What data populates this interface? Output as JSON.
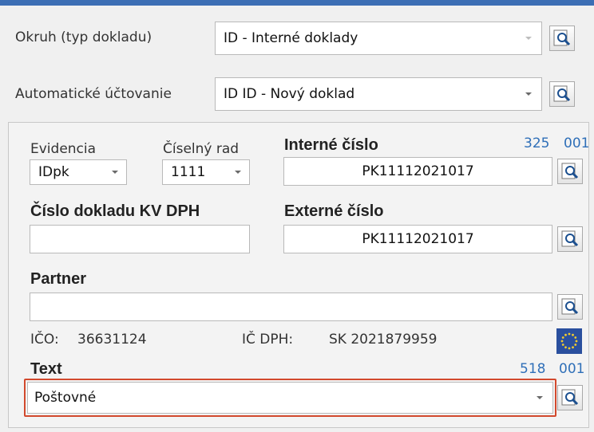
{
  "header": {
    "okruh_label": "Okruh (typ dokladu)",
    "okruh_value": "ID - Interné doklady",
    "auto_label": "Automatické účtovanie",
    "auto_value": "ID ID - Nový doklad"
  },
  "doc": {
    "evidencia_label": "Evidencia",
    "evidencia_value": "IDpk",
    "ciselny_rad_label": "Číselný rad",
    "ciselny_rad_value": "1111",
    "interne_cislo_label": "Interné číslo",
    "interne_cislo_counter": "325",
    "interne_cislo_counter2": "001",
    "interne_cislo_value": "PK11112021017",
    "kv_dph_label": "Číslo dokladu KV DPH",
    "kv_dph_value": "",
    "externe_cislo_label": "Externé číslo",
    "externe_cislo_value": "PK11112021017"
  },
  "partner": {
    "label": "Partner",
    "value": "",
    "ico_label": "IČO:",
    "ico_value": "36631124",
    "icdph_label": "IČ DPH:",
    "icdph_value": "SK 2021879959"
  },
  "text": {
    "label": "Text",
    "counter1": "518",
    "counter2": "001",
    "value": "Poštovné"
  },
  "colors": {
    "accent": "#3c6eb4",
    "link": "#2f6fb8",
    "highlight": "#d2492d"
  },
  "icons": [
    "lookup-icon",
    "dropdown-arrow-icon",
    "eu-flag-icon"
  ]
}
